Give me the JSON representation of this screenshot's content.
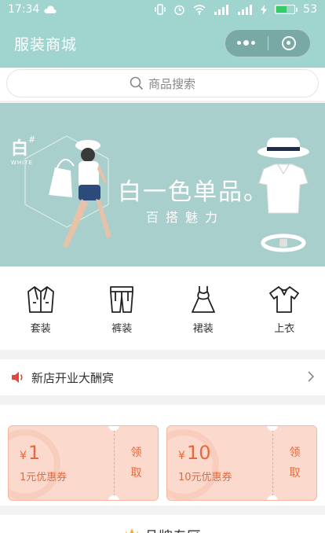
{
  "status_bar": {
    "time": "17:34",
    "battery": "53",
    "battery_level": 0.53
  },
  "titlebar": {
    "title": "服装商城"
  },
  "search": {
    "placeholder": "商品搜索"
  },
  "banner": {
    "logo": "白",
    "logo_sup": "#",
    "logo_small": "WHITE",
    "headline": "白一色单品。",
    "subline": "百搭魅力"
  },
  "categories": [
    {
      "label": "套装",
      "icon": "suit-icon"
    },
    {
      "label": "裤装",
      "icon": "pants-icon"
    },
    {
      "label": "裙装",
      "icon": "dress-icon"
    },
    {
      "label": "上衣",
      "icon": "shirt-icon"
    }
  ],
  "notice": {
    "text": "新店开业大酬宾"
  },
  "coupons": [
    {
      "currency": "¥",
      "amount": "1",
      "desc": "1元优惠券",
      "action_1": "领",
      "action_2": "取"
    },
    {
      "currency": "¥",
      "amount": "10",
      "desc": "10元优惠券",
      "action_1": "领",
      "action_2": "取"
    }
  ],
  "brand_section": {
    "title": "品牌专区"
  },
  "colors": {
    "theme": "#9fd4cf",
    "coupon_bg": "#fbd9cc",
    "coupon_text": "#e8683c",
    "speaker": "#e24b3b"
  }
}
